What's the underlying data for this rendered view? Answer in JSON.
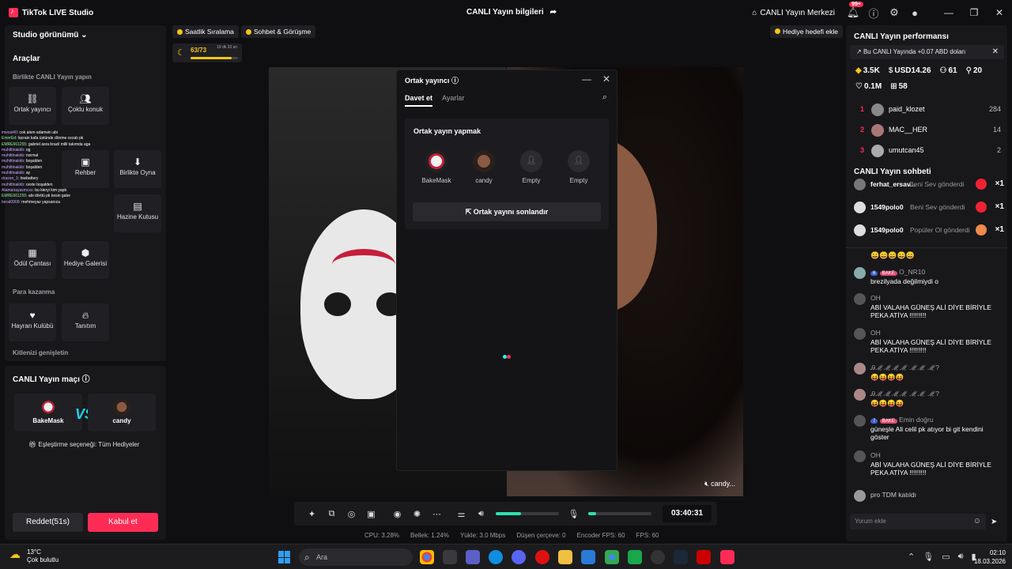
{
  "titlebar": {
    "app_title": "TikTok LIVE Studio",
    "center_title": "CANLI Yayın bilgileri",
    "hub_label": "CANLI Yayın Merkezi",
    "notif_badge": "99+"
  },
  "left": {
    "studio_view": "Studio görünümü",
    "tools_title": "Araçlar",
    "together_title": "Birlikte CANLI Yayın yapın",
    "tools": [
      {
        "label": "Ortak yayıncı",
        "icon": "link-icon"
      },
      {
        "label": "Çoklu konuk",
        "icon": "multi-guest-icon"
      },
      {
        "label": "Rehber",
        "icon": "guide-icon"
      },
      {
        "label": "Birlikte Oyna",
        "icon": "play-together-icon"
      },
      {
        "label": "Hazine Kutusu",
        "icon": "treasure-box-icon"
      },
      {
        "label": "Ödül Çantası",
        "icon": "reward-bag-icon"
      },
      {
        "label": "Hediye Galerisi",
        "icon": "gift-gallery-icon"
      },
      {
        "label": "Hayran Kulübü",
        "icon": "fan-club-icon"
      },
      {
        "label": "Tanıtım",
        "icon": "promote-icon"
      }
    ],
    "monetize_title": "Para kazanma",
    "expand_title": "Kitlenizi genişletin",
    "chat_overlay": [
      {
        "name": "imessi40",
        "text": ": cok alem adamsin abi"
      },
      {
        "name": "EmirrEd",
        "text": ": lacrain kafa üstünde dönme cezalı pk"
      },
      {
        "name": "EMRE661255",
        "text": ": gabriel asra brazil milli takımda aga"
      },
      {
        "name": "muhittinakkb",
        "text": ": og"
      },
      {
        "name": "muhittinakkb",
        "text": ": normal"
      },
      {
        "name": "muhittinakkb",
        "text": ": boşalden"
      },
      {
        "name": "muhittinakkb",
        "text": ": boşalden"
      },
      {
        "name": "muhittinakkb",
        "text": ": ay"
      },
      {
        "name": "draxon_1",
        "text": ": lowbattery"
      },
      {
        "name": "muhittinakkb",
        "text": ": ceste boşalden"
      },
      {
        "name": "Atamanayasmcxs",
        "text": ": bu kleryi kim yaptı"
      },
      {
        "name": "EMRE661255",
        "text": ": abi dörttü pk kesin gabe"
      },
      {
        "name": "berat0909",
        "text": ": mehmeyaz yapsanıza"
      }
    ]
  },
  "match": {
    "title": "CANLI Yayın maçı",
    "player1": "BakeMask",
    "player2": "candy",
    "vs": "VS",
    "option": "Eşleştirme seçeneği: Tüm Hediyeler",
    "reject": "Reddet(51s)",
    "accept": "Kabul et"
  },
  "top_chips": {
    "hourly": "Saatlik Sıralama",
    "chat_meet": "Sohbet & Görüşme",
    "gift_goal": "Hediye hedefi ekle"
  },
  "goal": {
    "value": "63/73",
    "time": "19 dk 33 sn",
    "progress": 0.86
  },
  "stage": {
    "right_label": "candy..."
  },
  "modal": {
    "title": "Ortak yayıncı",
    "tab_invite": "Davet et",
    "tab_settings": "Ayarlar",
    "section_title": "Ortak yayın yapmak",
    "slots": [
      {
        "label": "BakeMask",
        "filled": true
      },
      {
        "label": "candy",
        "filled": true
      },
      {
        "label": "Empty",
        "filled": false
      },
      {
        "label": "Empty",
        "filled": false
      }
    ],
    "end_button": "Ortak yayını sonlandır"
  },
  "bottombar": {
    "timer": "03:40:31",
    "volume": 0.4,
    "mic": 0.12,
    "stats": [
      "CPU: 3.28%",
      "Bellek: 1.24%",
      "Yükle: 3.0 Mbps",
      "Düşen çerçeve: 0",
      "Encoder FPS: 60",
      "FPS: 60"
    ]
  },
  "perf": {
    "title": "CANLI Yayın performansı",
    "note": "Bu CANLI Yayında +0.07 ABD doları",
    "row1": [
      "3.5K",
      "USD14.26",
      "61",
      "20"
    ],
    "row2": [
      "0.1M",
      "58"
    ],
    "ranks": [
      {
        "n": "1",
        "name": "paid_klozet",
        "v": "284"
      },
      {
        "n": "2",
        "name": "MAC__HER",
        "v": "14"
      },
      {
        "n": "3",
        "name": "umutcan45",
        "v": "2"
      }
    ]
  },
  "chat": {
    "title": "CANLI Yayın sohbeti",
    "gifts": [
      {
        "name": "ferhat_ersav...",
        "msg": "Beni Sev gönderdi",
        "x": "×1",
        "color": "#e23"
      },
      {
        "name": "1549polo0",
        "msg": "Beni Sev gönderdi",
        "x": "×1",
        "color": "#e23"
      },
      {
        "name": "1549polo0",
        "msg": "Popüler Ol gönderdi",
        "x": "×1",
        "color": "#f08a4b"
      }
    ],
    "emojis_top": "😄😄😄😄😄",
    "messages": [
      {
        "lvl": "6",
        "fan": "BAKE",
        "name": "O_NR10",
        "text": "brezilyada değilmiydi o"
      },
      {
        "lvl": "",
        "fan": "",
        "name": "OH",
        "text": "ABİ VALAHA GÜNEŞ ALİ DİYE BİRİYLE PEKA ATİYA !!!!!!!!!"
      },
      {
        "lvl": "",
        "fan": "",
        "name": "OH",
        "text": "ABİ VALAHA GÜNEŞ ALİ DİYE BİRİYLE PEKA ATİYA !!!!!!!!!"
      },
      {
        "lvl": "",
        "fan": "",
        "name": "Ꭿℳℳℳℳ ℳℳ ℳ?",
        "text": "😝😝😝😝"
      },
      {
        "lvl": "",
        "fan": "",
        "name": "Ꭿℳℳℳℳ ℳℳ ℳ?",
        "text": "😝😝😝😝"
      },
      {
        "lvl": "7",
        "fan": "BAKE",
        "name": "Emin doğru",
        "text": "güneşle Ali celil pk atıyor bi git kendini göster"
      },
      {
        "lvl": "",
        "fan": "",
        "name": "OH",
        "text": "ABİ VALAHA GÜNEŞ ALİ DİYE BİRİYLE PEKA ATİYA !!!!!!!!!"
      }
    ],
    "joined_name": "pro TDM",
    "joined_text": "katıldı",
    "input_placeholder": "Yorum ekle"
  },
  "taskbar": {
    "temp": "13°C",
    "weather": "Çok bulutlu",
    "search": "Ara",
    "time": "02:10",
    "date": "18.03.2026"
  }
}
